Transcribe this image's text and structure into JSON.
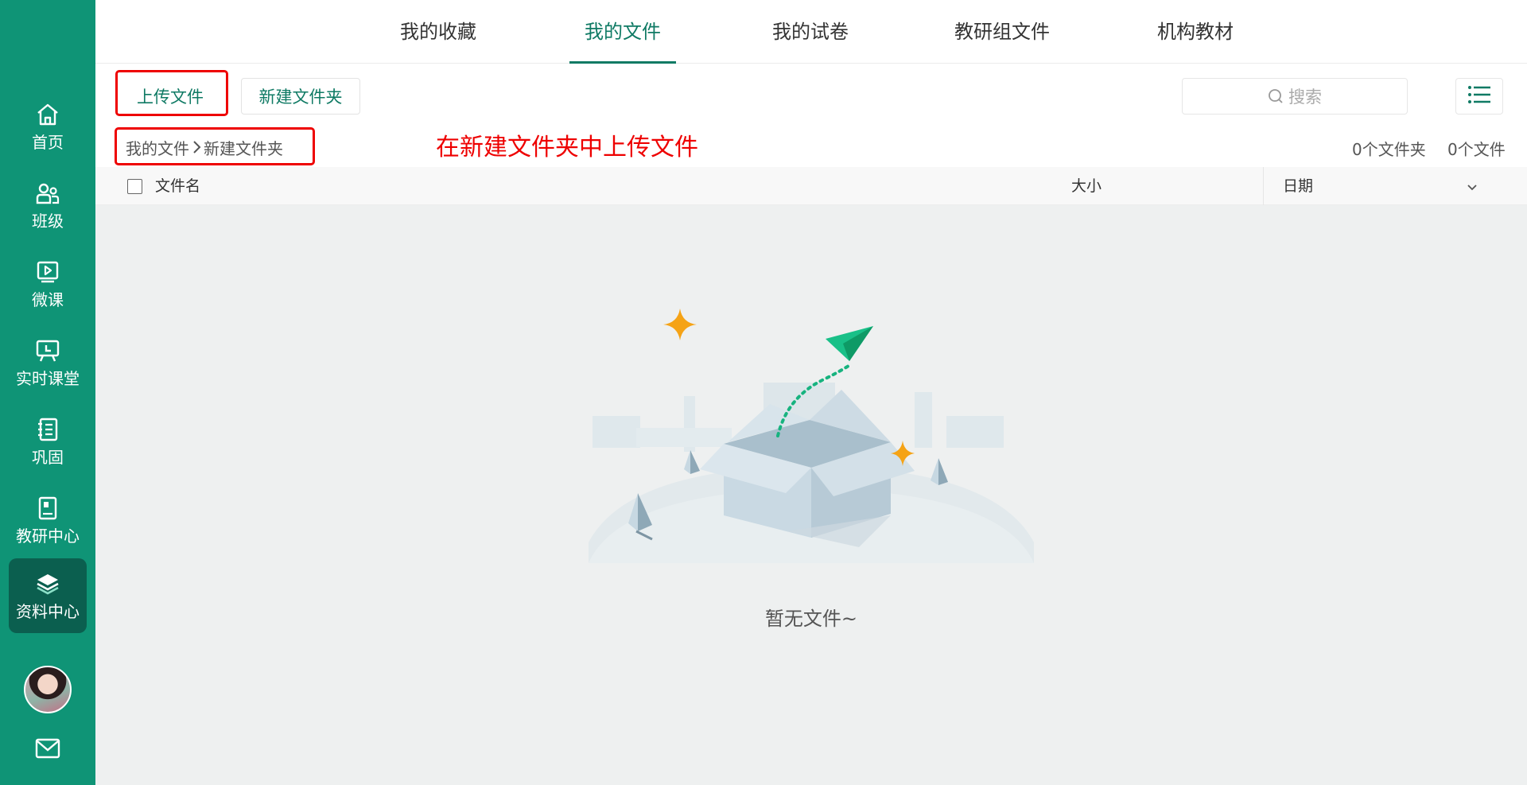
{
  "sidebar": {
    "items": [
      {
        "label": "首页",
        "icon": "home-icon"
      },
      {
        "label": "班级",
        "icon": "users-icon"
      },
      {
        "label": "微课",
        "icon": "video-icon"
      },
      {
        "label": "实时课堂",
        "icon": "board-icon"
      },
      {
        "label": "巩固",
        "icon": "notebook-icon"
      },
      {
        "label": "教研中心",
        "icon": "book-icon"
      },
      {
        "label": "资料中心",
        "icon": "layers-icon",
        "active": true
      }
    ],
    "mail_icon": "mail-icon"
  },
  "tabs": [
    {
      "label": "我的收藏"
    },
    {
      "label": "我的文件",
      "active": true
    },
    {
      "label": "我的试卷"
    },
    {
      "label": "教研组文件"
    },
    {
      "label": "机构教材"
    }
  ],
  "toolbar": {
    "upload_label": "上传文件",
    "new_folder_label": "新建文件夹",
    "search_placeholder": "搜索"
  },
  "breadcrumb": {
    "root": "我的文件",
    "current": "新建文件夹"
  },
  "annotation": "在新建文件夹中上传文件",
  "counts": {
    "folders": "0个文件夹",
    "files": "0个文件"
  },
  "table": {
    "columns": {
      "name": "文件名",
      "size": "大小",
      "date": "日期"
    }
  },
  "empty_text": "暂无文件~",
  "colors": {
    "brand": "#0f9476",
    "brand_dark": "#0b5f4f",
    "accent_text": "#0f7a64",
    "highlight": "#ee0000"
  }
}
